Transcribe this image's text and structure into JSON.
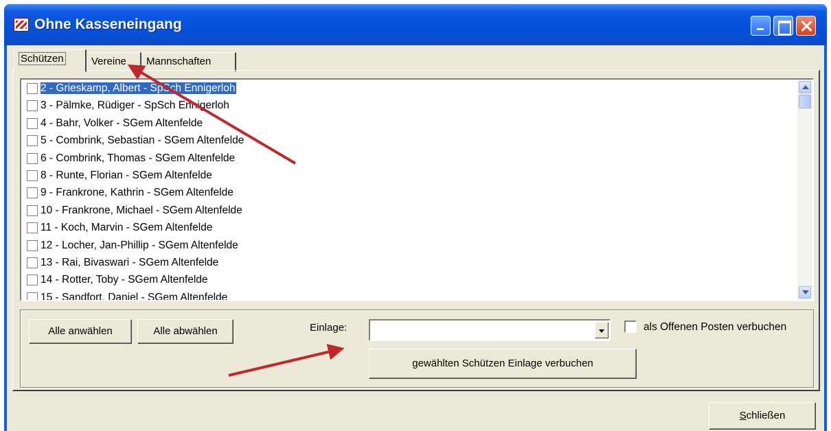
{
  "window": {
    "title": "Ohne Kasseneingang",
    "buttons": {
      "minimize": "minimize",
      "maximize": "maximize",
      "close": "close"
    }
  },
  "tabs": [
    {
      "label": "Schützen",
      "active": true
    },
    {
      "label": "Vereine",
      "active": false
    },
    {
      "label": "Mannschaften",
      "active": false
    }
  ],
  "list": {
    "items": [
      {
        "label": "2 - Grieskamp, Albert  - SpSch Ennigerloh",
        "checked": false,
        "selected": true
      },
      {
        "label": "3 - Pälmke, Rüdiger  - SpSch Ennigerloh",
        "checked": false,
        "selected": false
      },
      {
        "label": "4 - Bahr, Volker  - SGem Altenfelde",
        "checked": false,
        "selected": false
      },
      {
        "label": "5 - Combrink, Sebastian  - SGem Altenfelde",
        "checked": false,
        "selected": false
      },
      {
        "label": "6 -  Combrink, Thomas  - SGem Altenfelde",
        "checked": false,
        "selected": false
      },
      {
        "label": "8 -  Runte, Florian  - SGem Altenfelde",
        "checked": false,
        "selected": false
      },
      {
        "label": "9 - Frankrone, Kathrin  - SGem Altenfelde",
        "checked": false,
        "selected": false
      },
      {
        "label": "10 - Frankrone, Michael  - SGem Altenfelde",
        "checked": false,
        "selected": false
      },
      {
        "label": "11 - Koch, Marvin  - SGem Altenfelde",
        "checked": false,
        "selected": false
      },
      {
        "label": "12 - Locher, Jan-Phillip  - SGem Altenfelde",
        "checked": false,
        "selected": false
      },
      {
        "label": "13 - Rai, Bivaswari  - SGem Altenfelde",
        "checked": false,
        "selected": false
      },
      {
        "label": "14 - Rotter, Toby  - SGem Altenfelde",
        "checked": false,
        "selected": false
      },
      {
        "label": "15 - Sandfort, Daniel  - SGem Altenfelde",
        "checked": false,
        "selected": false
      }
    ]
  },
  "actions": {
    "select_all": "Alle anwählen",
    "deselect_all": "Alle abwählen",
    "einlage_label": "Einlage:",
    "einlage_value": "",
    "open_item_label": "als Offenen Posten verbuchen",
    "open_item_checked": false,
    "book_button": "gewählten Schützen Einlage verbuchen"
  },
  "footer": {
    "close_first": "S",
    "close_rest": "chließen"
  },
  "colors": {
    "titlebar": "#0551d9",
    "selection": "#316ac5",
    "dialog_face": "#ece9d8",
    "annotation_arrow": "#c0282d"
  }
}
